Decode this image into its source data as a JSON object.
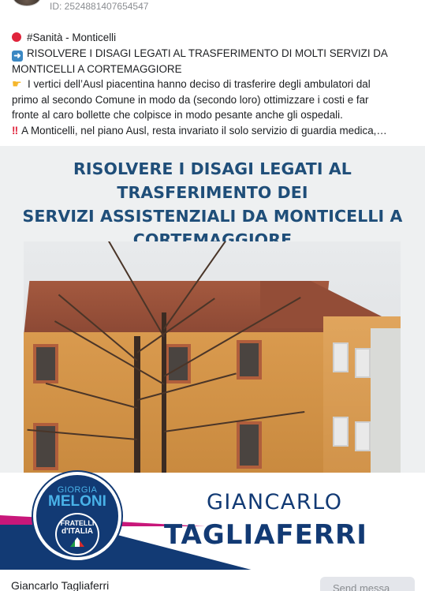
{
  "post": {
    "id_text": "ID: 2524881407654547",
    "lines": [
      "#Sanità - Monticelli",
      "RISOLVERE I DISAGI LEGATI AL TRASFERIMENTO DI MOLTI SERVIZI DA",
      "MONTICELLI A CORTEMAGGIORE",
      "I vertici dell’Ausl piacentina hanno deciso di trasferire degli ambulatori dal",
      "primo al secondo Comune in modo da (secondo loro) ottimizzare i costi e far",
      "fronte al caro bollette che colpisce in modo pesante anche gli ospedali.",
      "A Monticelli, nel piano Ausl, resta invariato il solo servizio di guardia medica,…"
    ],
    "bangbang": "‼"
  },
  "banner": {
    "title_lines": [
      "RISOLVERE I DISAGI LEGATI AL TRASFERIMENTO DEI",
      "SERVIZI ASSISTENZIALI DA MONTICELLI A",
      "CORTEMAGGIORE"
    ],
    "logo": {
      "line1": "GIORGIA",
      "line2": "MELONI",
      "line3": "FRATELLI",
      "line4": "d'ITALIA"
    },
    "candidate_first": "GIANCARLO",
    "candidate_last": "TAGLIAFERRI"
  },
  "footer": {
    "name": "Giancarlo Tagliaferri",
    "send_label": "Send messa"
  },
  "icons": {
    "red_dot": "red-circle-icon",
    "arrow": "right-arrow-icon",
    "hand": "pointing-hand-icon"
  },
  "colors": {
    "title_blue": "#1f4e79",
    "party_blue": "#123a74",
    "party_pink": "#c8177a",
    "light_blue": "#49b2e8"
  }
}
